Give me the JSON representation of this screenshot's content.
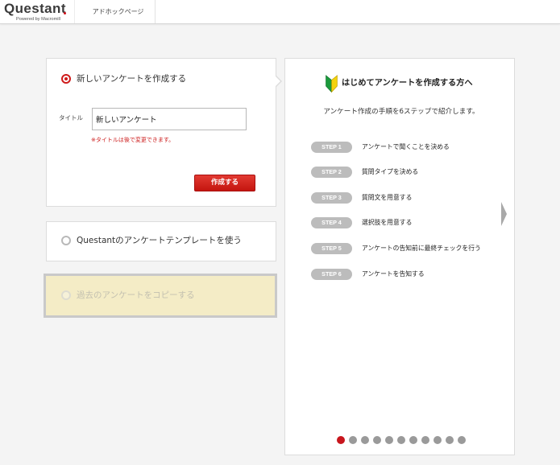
{
  "header": {
    "logo": "Questant",
    "powered_by": "Powered by Macromill",
    "tab": "アドホックページ"
  },
  "create_card": {
    "option_label": "新しいアンケートを作成する",
    "selected": true,
    "title_label": "タイトル",
    "title_value": "新しいアンケート",
    "note": "※タイトルは後で変更できます。",
    "submit_label": "作成する"
  },
  "template_card": {
    "option_label": "Questantのアンケートテンプレートを使う",
    "selected": false
  },
  "copy_card": {
    "option_label": "過去のアンケートをコピーする",
    "selected": false,
    "disabled": true
  },
  "guide": {
    "icon": "beginner-mark-icon",
    "title": "はじめてアンケートを作成する方へ",
    "subtitle": "アンケート作成の手順を6ステップで紹介します。",
    "steps": [
      {
        "badge": "STEP 1",
        "text": "アンケートで聞くことを決める"
      },
      {
        "badge": "STEP 2",
        "text": "質問タイプを決める"
      },
      {
        "badge": "STEP 3",
        "text": "質問文を用意する"
      },
      {
        "badge": "STEP 4",
        "text": "選択肢を用意する"
      },
      {
        "badge": "STEP 5",
        "text": "アンケートの告知前に最終チェックを行う"
      },
      {
        "badge": "STEP 6",
        "text": "アンケートを告知する"
      }
    ],
    "next_icon": "chevron-right-icon",
    "pagination": {
      "total": 11,
      "current": 1
    }
  },
  "colors": {
    "accent": "#cc1b1b",
    "badge": "#bcbcbc",
    "disabled_bg": "#f4ecc6",
    "dot_inactive": "#9a9a9a"
  }
}
